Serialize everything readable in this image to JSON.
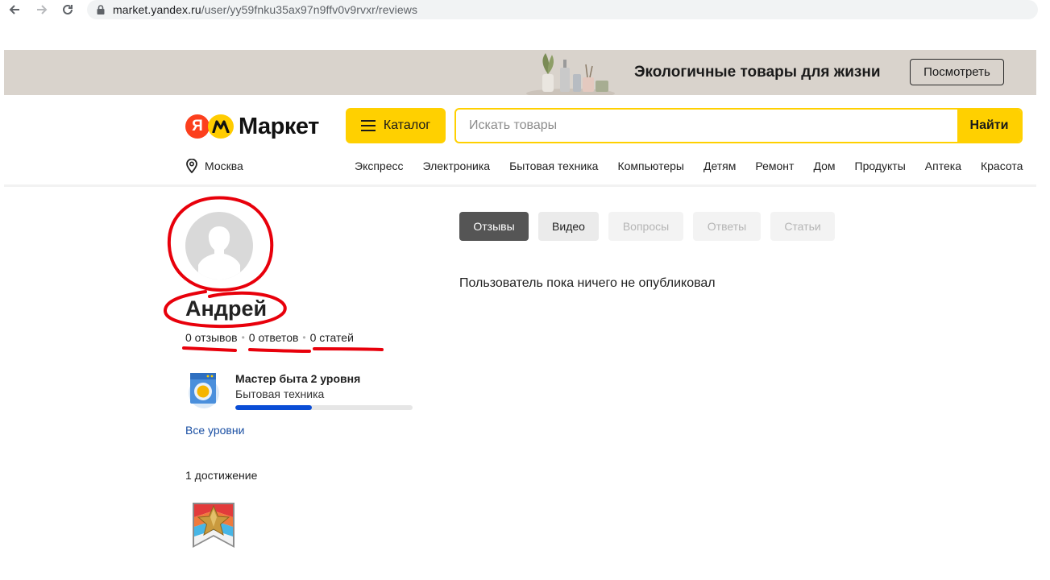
{
  "browser": {
    "url_host": "market.yandex.ru",
    "url_path": "/user/yy59fnku35ax97n9ffv0v9rvxr/reviews"
  },
  "promo": {
    "text": "Экологичные товары для жизни",
    "button_label": "Посмотреть"
  },
  "header": {
    "logo_letter": "Я",
    "logo_text": "Маркет",
    "catalog_label": "Каталог",
    "search_placeholder": "Искать товары",
    "search_button_label": "Найти",
    "location": "Москва",
    "nav_items": [
      "Экспресс",
      "Электроника",
      "Бытовая техника",
      "Компьютеры",
      "Детям",
      "Ремонт",
      "Дом",
      "Продукты",
      "Аптека",
      "Красота"
    ]
  },
  "profile": {
    "name": "Андрей",
    "stats": [
      "0 отзывов",
      "0 ответов",
      "0 статей"
    ],
    "level": {
      "title": "Мастер быта 2 уровня",
      "category": "Бытовая техника",
      "progress": 0.43
    },
    "all_levels_link": "Все уровни",
    "achievements_count": "1 достижение"
  },
  "tabs": [
    {
      "label": "Отзывы",
      "state": "active"
    },
    {
      "label": "Видео",
      "state": "normal"
    },
    {
      "label": "Вопросы",
      "state": "disabled"
    },
    {
      "label": "Ответы",
      "state": "disabled"
    },
    {
      "label": "Статьи",
      "state": "disabled"
    }
  ],
  "empty_message": "Пользователь пока ничего не опубликовал",
  "colors": {
    "accent_yellow": "#ffd000",
    "logo_red": "#fc3f1d",
    "link_blue": "#1a4fa3",
    "progress_blue": "#0a4dd6",
    "annotation_red": "#e8000b"
  },
  "icons": [
    "back-arrow-icon",
    "forward-arrow-icon",
    "reload-icon",
    "lock-icon",
    "menu-icon",
    "location-pin-icon",
    "avatar-silhouette-icon",
    "washing-machine-icon",
    "star-badge-icon"
  ]
}
